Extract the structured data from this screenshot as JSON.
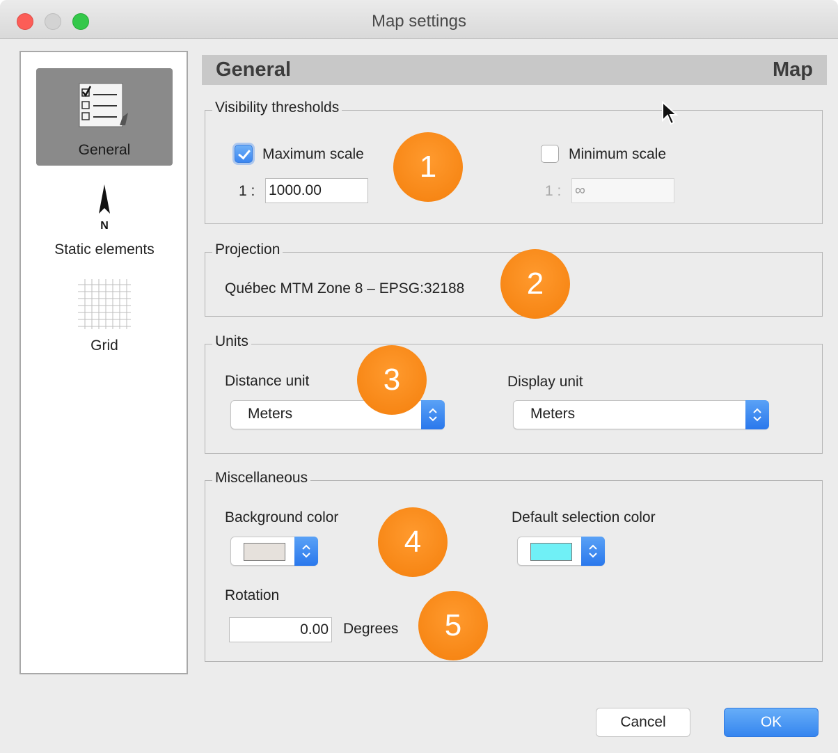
{
  "window": {
    "title": "Map settings"
  },
  "sidebar": {
    "items": [
      {
        "label": "General",
        "icon": "checklist-icon",
        "selected": true
      },
      {
        "label": "Static elements",
        "icon": "north-arrow-icon",
        "selected": false
      },
      {
        "label": "Grid",
        "icon": "grid-icon",
        "selected": false
      }
    ]
  },
  "panel": {
    "title": "General",
    "context": "Map"
  },
  "visibility": {
    "legend": "Visibility thresholds",
    "max_scale": {
      "label": "Maximum scale",
      "checked": true,
      "prefix": "1 :",
      "value": "1000.00"
    },
    "min_scale": {
      "label": "Minimum scale",
      "checked": false,
      "prefix": "1 :",
      "value": "∞"
    }
  },
  "projection": {
    "legend": "Projection",
    "value": "Québec MTM Zone 8 – EPSG:32188"
  },
  "units": {
    "legend": "Units",
    "distance_label": "Distance unit",
    "distance_value": "Meters",
    "display_label": "Display unit",
    "display_value": "Meters"
  },
  "misc": {
    "legend": "Miscellaneous",
    "background_label": "Background color",
    "background_color": "#e6e1dc",
    "selection_label": "Default selection color",
    "selection_color": "#70f0f6",
    "rotation_label": "Rotation",
    "rotation_value": "0.00",
    "rotation_unit": "Degrees"
  },
  "callouts": [
    "1",
    "2",
    "3",
    "4",
    "5"
  ],
  "buttons": {
    "cancel": "Cancel",
    "ok": "OK"
  },
  "colors": {
    "accent": "#3a86f0",
    "callout": "#f5820f"
  }
}
